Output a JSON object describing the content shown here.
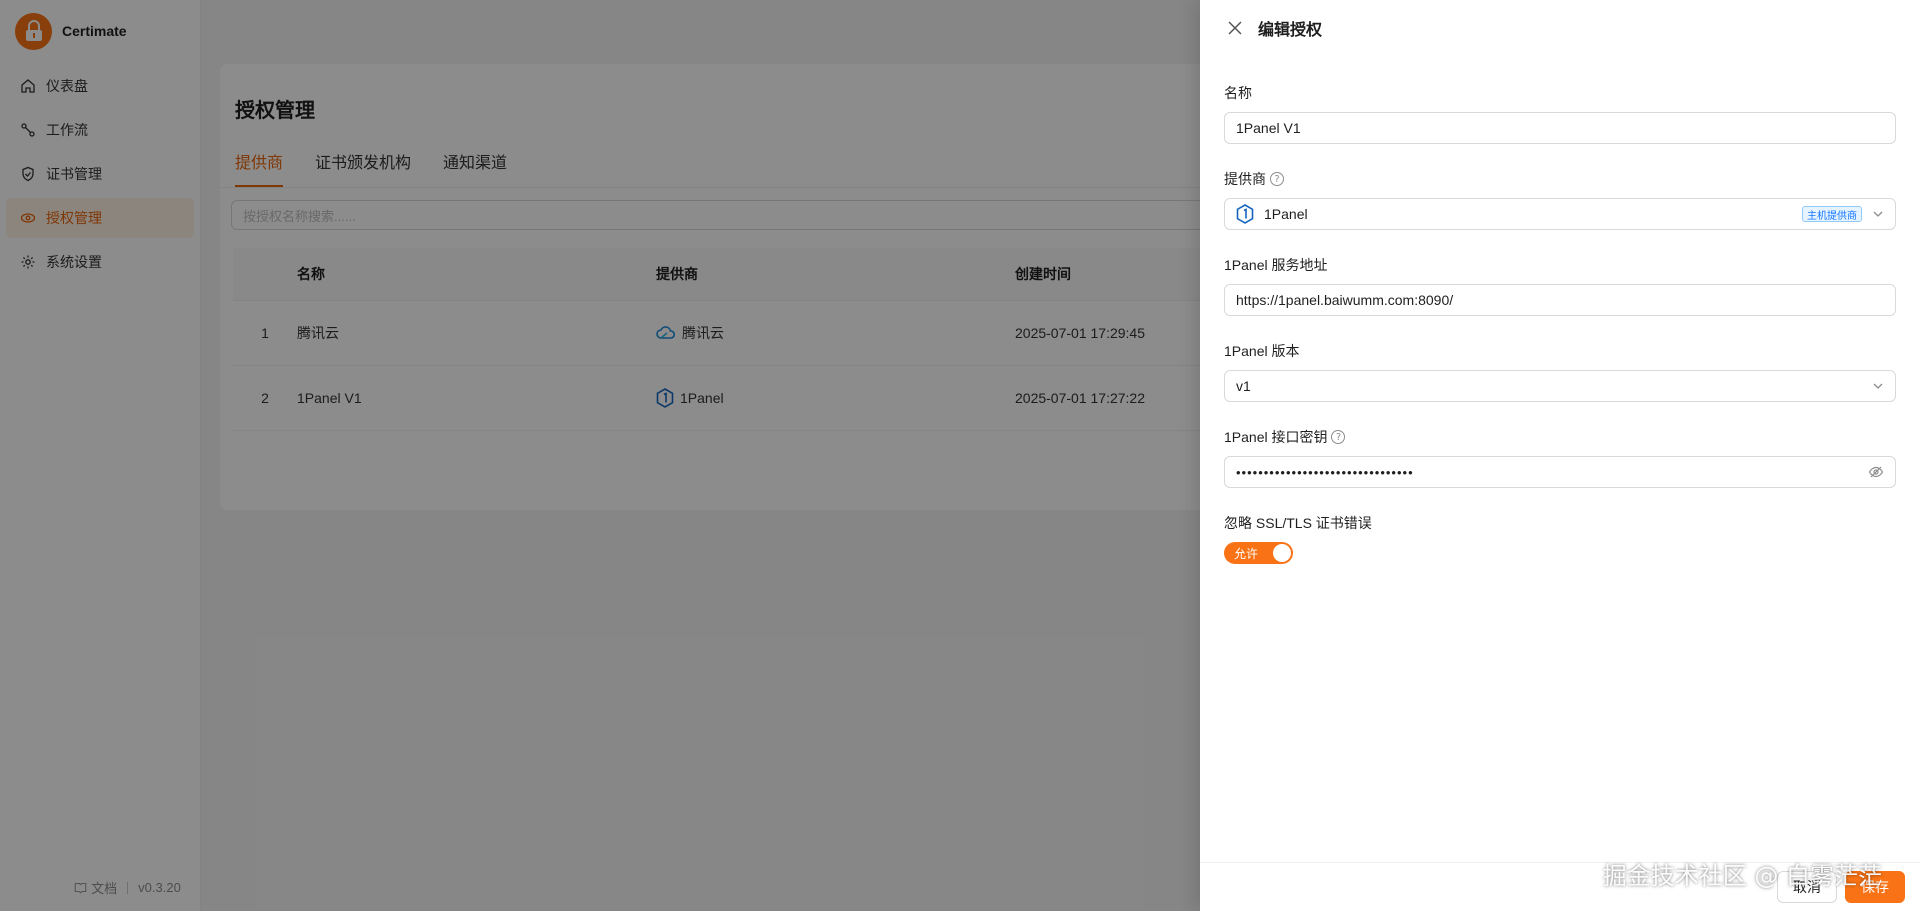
{
  "app": {
    "name": "Certimate",
    "version": "v0.3.20",
    "docs_label": "文档"
  },
  "sidebar": {
    "items": [
      {
        "label": "仪表盘",
        "icon": "home-icon",
        "active": false
      },
      {
        "label": "工作流",
        "icon": "workflow-icon",
        "active": false
      },
      {
        "label": "证书管理",
        "icon": "shield-check-icon",
        "active": false
      },
      {
        "label": "授权管理",
        "icon": "access-icon",
        "active": true
      },
      {
        "label": "系统设置",
        "icon": "gear-icon",
        "active": false
      }
    ]
  },
  "page": {
    "title": "授权管理",
    "tabs": [
      {
        "label": "提供商",
        "active": true
      },
      {
        "label": "证书颁发机构",
        "active": false
      },
      {
        "label": "通知渠道",
        "active": false
      }
    ],
    "search_placeholder": "按授权名称搜索......"
  },
  "table": {
    "columns": [
      "",
      "名称",
      "提供商",
      "创建时间"
    ],
    "rows": [
      {
        "index": "1",
        "name": "腾讯云",
        "provider": "腾讯云",
        "provider_icon": "tencent-cloud-icon",
        "created": "2025-07-01 17:29:45"
      },
      {
        "index": "2",
        "name": "1Panel V1",
        "provider": "1Panel",
        "provider_icon": "1panel-icon",
        "created": "2025-07-01 17:27:22"
      }
    ]
  },
  "drawer": {
    "title": "编辑授权",
    "fields": {
      "name": {
        "label": "名称",
        "value": "1Panel V1"
      },
      "provider": {
        "label": "提供商",
        "value": "1Panel",
        "badge": "主机提供商"
      },
      "url": {
        "label": "1Panel 服务地址",
        "value": "https://1panel.baiwumm.com:8090/"
      },
      "version": {
        "label": "1Panel 版本",
        "value": "v1"
      },
      "api_key": {
        "label": "1Panel 接口密钥",
        "value": "••••••••••••••••••••••••••••••••"
      },
      "ignore_ssl": {
        "label": "忽略 SSL/TLS 证书错误",
        "switch_text": "允许"
      }
    },
    "cancel_label": "取消",
    "save_label": "保存"
  },
  "watermark": "掘金技术社区 @ 白雾茫茫",
  "colors": {
    "accent": "#f97316",
    "overlay": "rgba(0,0,0,0.45)"
  }
}
